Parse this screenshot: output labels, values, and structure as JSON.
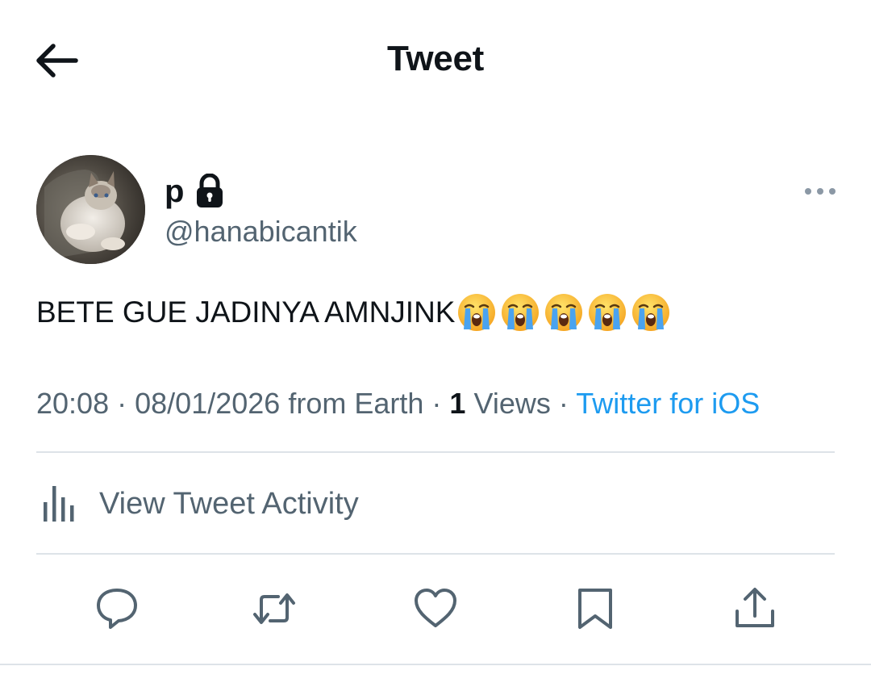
{
  "header": {
    "title": "Tweet",
    "back_icon": "arrow-left-icon"
  },
  "author": {
    "display_name": "p",
    "handle": "@hanabicantik",
    "protected_icon": "lock-icon",
    "avatar_desc": "cat photo"
  },
  "tweet": {
    "text": "BETE GUE JADINYA AMNJINK",
    "emojis": [
      "loudly-crying-face",
      "loudly-crying-face",
      "loudly-crying-face",
      "loudly-crying-face",
      "loudly-crying-face"
    ]
  },
  "meta": {
    "time": "20:08",
    "date": "08/01/2026",
    "location": "from Earth",
    "sep": "·",
    "views_count": "1",
    "views_label": "Views",
    "source": "Twitter for iOS"
  },
  "activity": {
    "label": "View Tweet Activity",
    "icon": "bar-chart-icon"
  },
  "actions": [
    {
      "name": "reply",
      "icon": "reply-icon"
    },
    {
      "name": "retweet",
      "icon": "retweet-icon"
    },
    {
      "name": "like",
      "icon": "heart-icon"
    },
    {
      "name": "bookmark",
      "icon": "bookmark-icon"
    },
    {
      "name": "share",
      "icon": "share-icon"
    }
  ],
  "colors": {
    "text": "#0f1419",
    "secondary": "#536471",
    "link": "#1d9bf0",
    "divider": "#dde3e8"
  }
}
